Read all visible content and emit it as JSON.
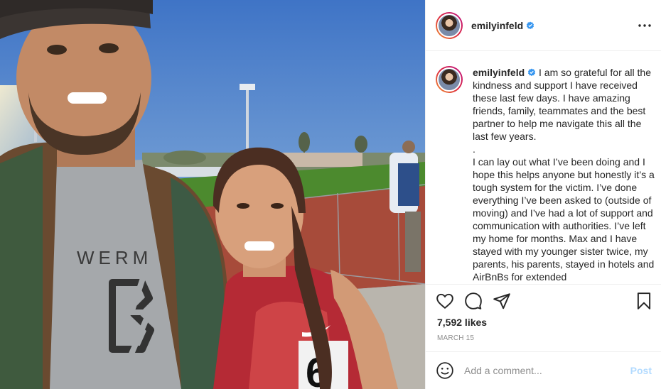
{
  "post": {
    "username": "emilyinfeld",
    "verified": true,
    "caption_paragraphs": [
      "I am so grateful for all the kindness and support I have received these last few days. I have amazing friends, family, teammates and the best partner to help me navigate this all the last few years.",
      ".",
      "I can lay out what I’ve been doing and I hope this helps anyone but honestly it’s a tough system for the victim. I’ve done everything I’ve been asked to (outside of moving) and I’ve had a lot of support and communication with authorities. I’ve left my home for months. Max and I have stayed with my younger sister twice, my parents, his parents, stayed in hotels and AirBnBs for extended"
    ],
    "likes": "7,592 likes",
    "date": "MARCH 15"
  },
  "photo": {
    "shirt_text": "WERM",
    "bib_number": "6"
  },
  "comment_box": {
    "placeholder": "Add a comment...",
    "post_label": "Post"
  },
  "icons": {
    "more": "more-options-icon",
    "like": "heart-icon",
    "comment": "comment-icon",
    "share": "share-icon",
    "save": "bookmark-icon",
    "emoji": "emoji-icon",
    "verified": "verified-badge-icon"
  },
  "colors": {
    "verified_blue": "#3897f0",
    "post_button_disabled": "#b3dbff",
    "secondary_text": "#8e8e8e"
  }
}
